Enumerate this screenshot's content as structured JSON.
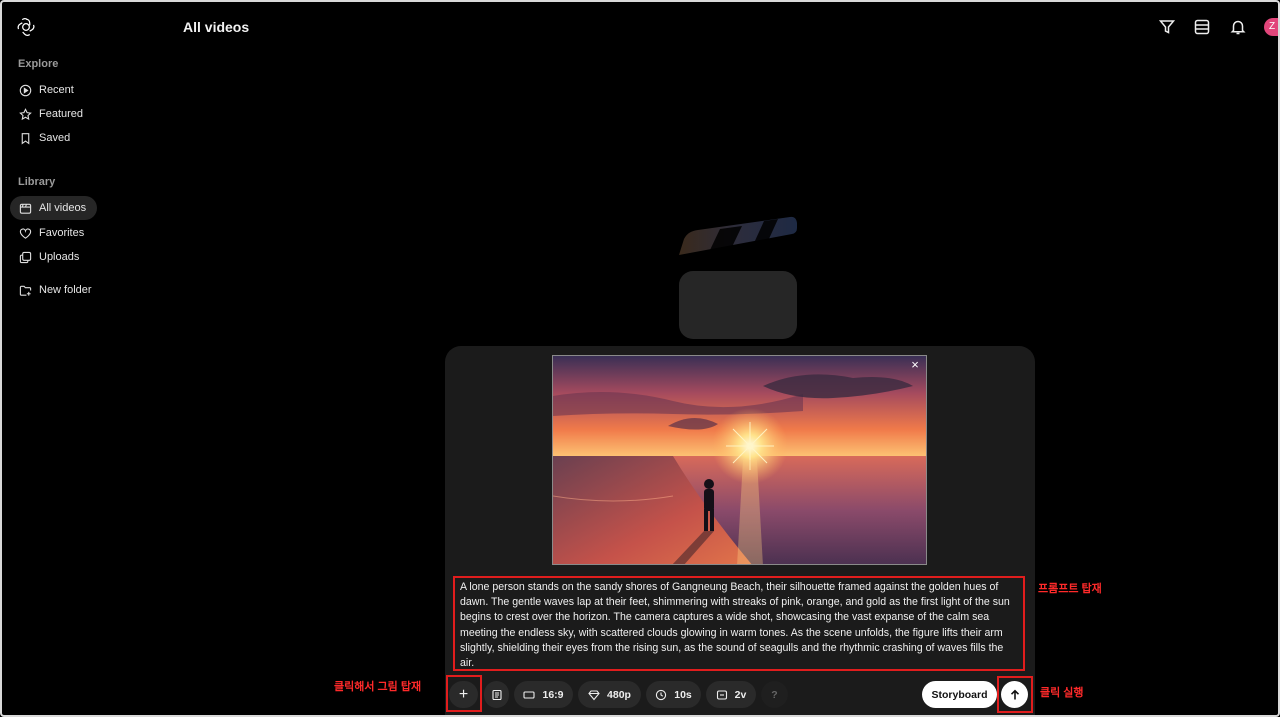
{
  "sidebar": {
    "sections": [
      {
        "title": "Explore"
      },
      {
        "title": "Library"
      }
    ],
    "explore_items": [
      {
        "label": "Recent",
        "icon": "play-circle-icon"
      },
      {
        "label": "Featured",
        "icon": "star-icon"
      },
      {
        "label": "Saved",
        "icon": "bookmark-icon"
      }
    ],
    "library_items": [
      {
        "label": "All videos",
        "icon": "video-library-icon",
        "active": true
      },
      {
        "label": "Favorites",
        "icon": "heart-icon"
      },
      {
        "label": "Uploads",
        "icon": "uploads-icon"
      }
    ],
    "new_folder": {
      "label": "New folder",
      "icon": "folder-plus-icon"
    }
  },
  "header": {
    "title": "All videos",
    "icons": [
      "filter-icon",
      "layout-icon",
      "bell-icon"
    ],
    "avatar_letter": "Z"
  },
  "composer": {
    "prompt": "A lone person stands on the sandy shores of Gangneung Beach, their silhouette framed against the golden hues of dawn. The gentle waves lap at their feet, shimmering with streaks of pink, orange, and gold as the first light of the sun begins to crest over the horizon. The camera captures a wide shot, showcasing the vast expanse of the calm sea meeting the endless sky, with scattered clouds glowing in warm tones. As the scene unfolds, the figure lifts their arm slightly, shielding their eyes from the rising sun, as the sound of seagulls and the rhythmic crashing of waves fills the air.",
    "close_label": "×",
    "toolbar": {
      "add_label": "+",
      "aspect": "16:9",
      "resolution": "480p",
      "duration": "10s",
      "variations": "2v",
      "help": "?",
      "storyboard": "Storyboard"
    }
  },
  "annotations": {
    "prompt_note": "프롬프트 탑재",
    "add_note": "클릭해서 그림 탑재",
    "send_note": "클릭 실행"
  },
  "colors": {
    "background": "#000000",
    "panel": "#1b1b1b",
    "annotation_red": "#e11d1d",
    "avatar": "#e1457a"
  }
}
